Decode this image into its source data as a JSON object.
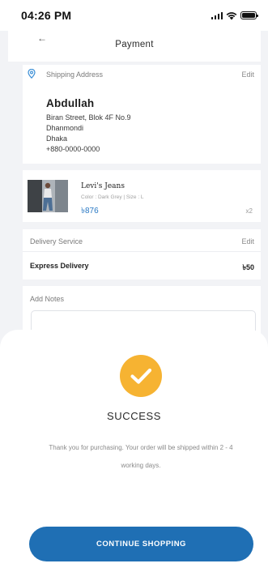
{
  "status_bar": {
    "time": "04:26 PM"
  },
  "header": {
    "title": "Payment"
  },
  "shipping": {
    "label": "Shipping Address",
    "edit_label": "Edit",
    "name": "Abdullah",
    "address_lines": [
      "Biran Street, Blok 4F No.9",
      "Dhanmondi",
      "Dhaka",
      "+880-0000-0000"
    ]
  },
  "product": {
    "name": "Levi's Jeans",
    "meta": "Color : Dark Grey  |  Size : L",
    "price": "৳876",
    "quantity": "x2"
  },
  "delivery": {
    "label": "Delivery Service",
    "edit_label": "Edit",
    "service_name": "Express Delivery",
    "service_price": "৳50"
  },
  "notes": {
    "label": "Add Notes"
  },
  "success": {
    "title": "SUCCESS",
    "message": "Thank you for purchasing. Your order will be shipped within 2 - 4 working days.",
    "button_label": "CONTINUE SHOPPING"
  },
  "colors": {
    "accent_blue": "#1f6fb4",
    "price_blue": "#2a79c4",
    "success_badge": "#f6b332"
  }
}
